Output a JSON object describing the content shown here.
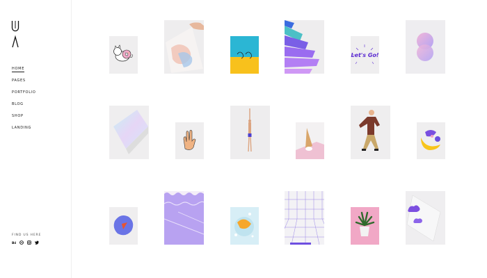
{
  "sidebar": {
    "logo_icon": "U-logo-icon",
    "nav": [
      {
        "label": "Home",
        "active": true
      },
      {
        "label": "Pages",
        "active": false
      },
      {
        "label": "Portfolio",
        "active": false
      },
      {
        "label": "Blog",
        "active": false
      },
      {
        "label": "Shop",
        "active": false
      },
      {
        "label": "Landing",
        "active": false
      }
    ],
    "find_us_label": "Find us here",
    "socials": [
      "behance-icon",
      "dribbble-icon",
      "instagram-icon",
      "twitter-icon"
    ]
  },
  "gallery": {
    "items": [
      {
        "name": "donut-cat-sticker"
      },
      {
        "name": "watercolor-paper-hand"
      },
      {
        "name": "yellow-teal-sketch-card"
      },
      {
        "name": "purple-color-swatches"
      },
      {
        "name": "lets-go-lettering",
        "text": "Let's Go!"
      },
      {
        "name": "gradient-pink-blob"
      },
      {
        "name": "holographic-notebook"
      },
      {
        "name": "hand-sign-drawing"
      },
      {
        "name": "swimmer-figure"
      },
      {
        "name": "dropped-ice-cream"
      },
      {
        "name": "dancing-man-photo"
      },
      {
        "name": "banana-character"
      },
      {
        "name": "blue-blob-character"
      },
      {
        "name": "purple-pool-water"
      },
      {
        "name": "orange-slice-splash"
      },
      {
        "name": "purple-grid-room"
      },
      {
        "name": "plant-in-pink"
      },
      {
        "name": "purple-clouds-glass"
      }
    ]
  }
}
